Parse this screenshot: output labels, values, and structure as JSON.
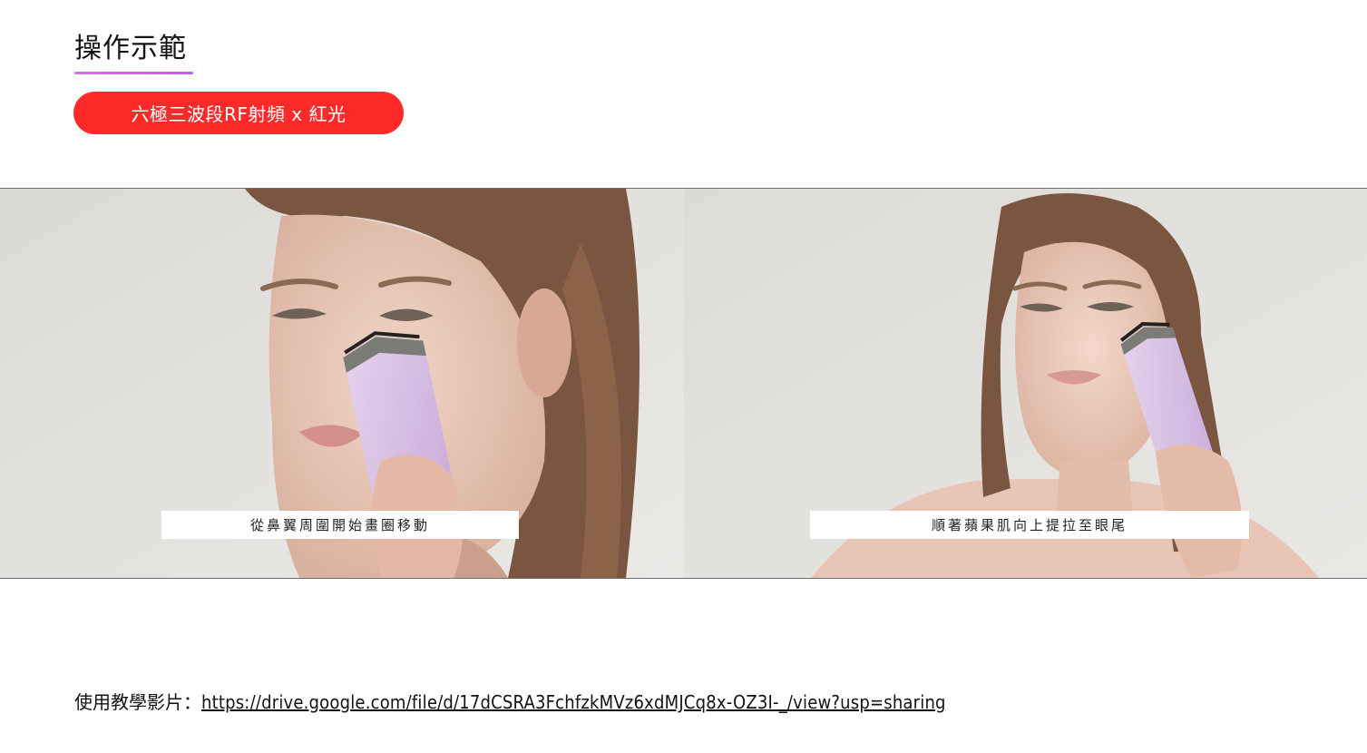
{
  "header": {
    "title": "操作示範",
    "badge": "六極三波段RF射頻 x 紅光"
  },
  "photos": [
    {
      "caption": "從鼻翼周圍開始畫圈移動"
    },
    {
      "caption": "順著蘋果肌向上提拉至眼尾"
    }
  ],
  "tutorial": {
    "label": "使用教學影片：",
    "link_text": "https://drive.google.com/file/d/17dCSRA3FchfzkMVz6xdMJCq8x-OZ3I-_/view?usp=sharing"
  },
  "colors": {
    "accent": "#fe2a2a",
    "underline": "#d96fe0",
    "device": "#d8bfe6"
  }
}
